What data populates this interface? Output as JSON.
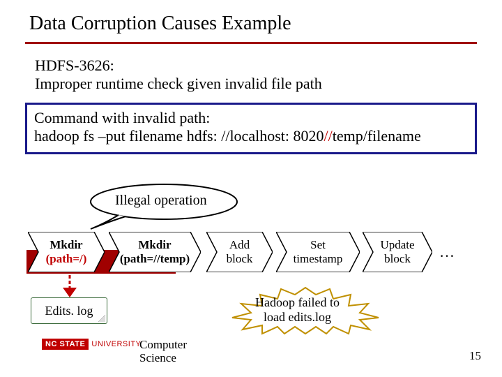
{
  "title": "Data Corruption Causes Example",
  "issue_id": "HDFS-3626:",
  "issue_desc": "Improper runtime check given invalid file path",
  "command_box": {
    "line1": "Command with invalid path:",
    "line2_prefix": "hadoop fs –put filename hdfs: //localhost: 8020",
    "line2_emph": "//",
    "line2_suffix": "temp/filename"
  },
  "illegal_label": "Illegal operation",
  "boxes": {
    "b1_line1": "Mkdir",
    "b1_line2": "(path=/)",
    "b2_line1": "Mkdir",
    "b2_line2": "(path=//temp)",
    "b3_line1": "Add",
    "b3_line2": "block",
    "b4_line1": "Set",
    "b4_line2": "timestamp",
    "b5_line1": "Update",
    "b5_line2": "block",
    "ellipsis": "…"
  },
  "edits_log": "Edits. log",
  "fail": {
    "line1": "Hadoop failed to",
    "line2": "load edits.log"
  },
  "footer": {
    "badge": "NC STATE",
    "univ": "UNIVERSITY",
    "dept_line1": "Computer",
    "dept_line2": "Science"
  },
  "page_number": "15",
  "colors": {
    "accent_red": "#a00000",
    "emphasis_red": "#c00000",
    "box_blue": "#1a1a8a"
  }
}
